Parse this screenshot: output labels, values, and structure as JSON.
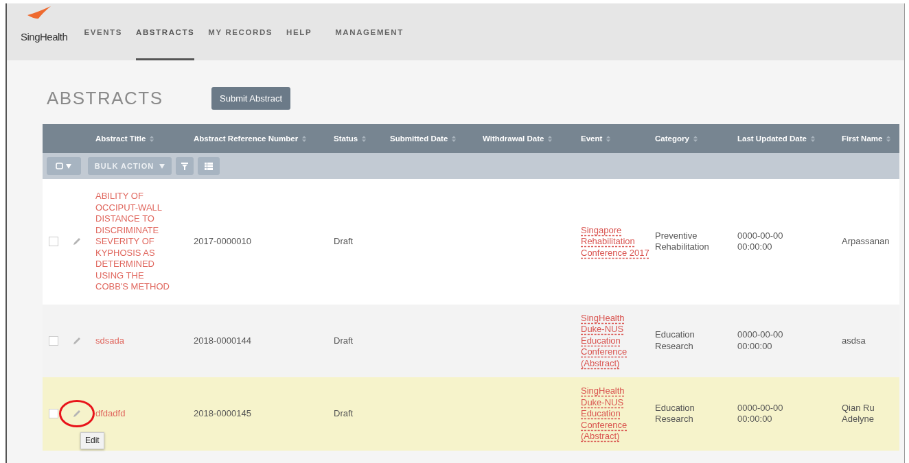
{
  "nav": {
    "logo": "SingHealth",
    "items": [
      {
        "label": "EVENTS",
        "selected": false
      },
      {
        "label": "ABSTRACTS",
        "selected": true
      },
      {
        "label": "MY RECORDS",
        "selected": false
      },
      {
        "label": "HELP",
        "selected": false
      },
      {
        "label": "MANAGEMENT",
        "selected": false
      }
    ]
  },
  "page_title": "ABSTRACTS",
  "submit_button": "Submit Abstract",
  "table": {
    "columns": [
      "Abstract Title",
      "Abstract Reference Number",
      "Status",
      "Submitted Date",
      "Withdrawal Date",
      "Event",
      "Category",
      "Last Updated Date",
      "First Name"
    ],
    "toolbar": {
      "bulk_action": "BULK ACTION"
    },
    "rows": [
      {
        "checked": false,
        "highlighted": false,
        "circled": false,
        "title": "ABILITY OF OCCIPUT-WALL DISTANCE TO DISCRIMINATE SEVERITY OF KYPHOSIS AS DETERMINED USING THE COBB'S METHOD",
        "reference": "2017-0000010",
        "status": "Draft",
        "event": "Singapore Rehabilitation Conference 2017",
        "category": "Preventive Rehabilitation",
        "last_updated": "0000-00-00 00:00:00",
        "first_name": "Arpassanan"
      },
      {
        "checked": false,
        "highlighted": false,
        "circled": false,
        "title": "sdsada",
        "reference": "2018-0000144",
        "status": "Draft",
        "event": "SingHealth Duke-NUS Education Conference (Abstract)",
        "category": "Education Research",
        "last_updated": "0000-00-00 00:00:00",
        "first_name": "asdsa"
      },
      {
        "checked": false,
        "highlighted": true,
        "circled": true,
        "tooltip": "Edit",
        "title": "dfdadfd",
        "reference": "2018-0000145",
        "status": "Draft",
        "event": "SingHealth Duke-NUS Education Conference (Abstract)",
        "category": "Education Research",
        "last_updated": "0000-00-00 00:00:00",
        "first_name": "Qian Ru Adelyne"
      }
    ]
  }
}
